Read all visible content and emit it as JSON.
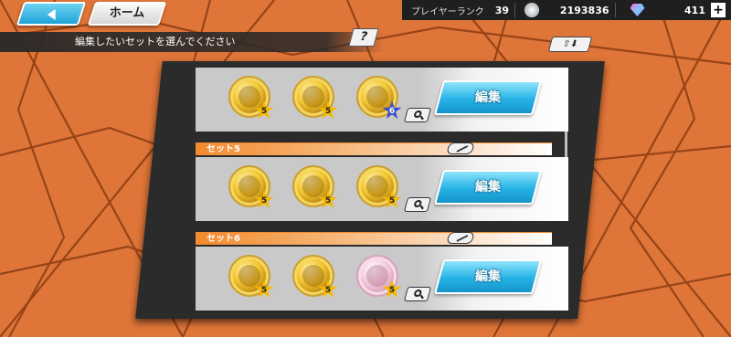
{
  "header": {
    "home_label": "ホーム",
    "player_rank_label": "プレイヤーランク",
    "player_rank": "39",
    "coins": "2193836",
    "gems": "411",
    "plus_label": "+"
  },
  "subheader": {
    "instruction": "編集したいセットを選んでください",
    "help_label": "?",
    "sort_label": "⇧⬇"
  },
  "sets": [
    {
      "label": "",
      "edit_label": "編集",
      "medals": [
        {
          "type": "gold",
          "rank": "5"
        },
        {
          "type": "gold",
          "rank": "5"
        },
        {
          "type": "gold",
          "rank": "6",
          "star": "blue"
        }
      ]
    },
    {
      "label": "セット5",
      "edit_label": "編集",
      "medals": [
        {
          "type": "gold",
          "rank": "5"
        },
        {
          "type": "gold",
          "rank": "5"
        },
        {
          "type": "gold",
          "rank": "5"
        }
      ]
    },
    {
      "label": "セット6",
      "edit_label": "編集",
      "medals": [
        {
          "type": "gold",
          "rank": "5"
        },
        {
          "type": "gold",
          "rank": "5"
        },
        {
          "type": "pink",
          "rank": "5"
        }
      ]
    }
  ],
  "colors": {
    "background": "#e0773a",
    "accent_blue": "#26b2e6",
    "panel": "#2b2b2b",
    "tab_orange": "#f28a2e"
  }
}
